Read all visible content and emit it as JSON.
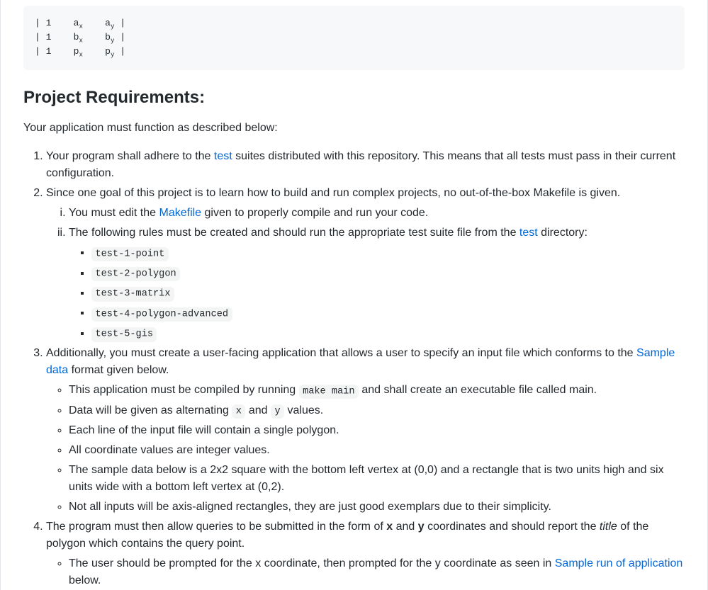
{
  "matrix": {
    "rows": [
      {
        "c0": "| 1",
        "v": "a",
        "s1": "x",
        "w": "a",
        "s2": "y",
        "end": "|"
      },
      {
        "c0": "| 1",
        "v": "b",
        "s1": "x",
        "w": "b",
        "s2": "y",
        "end": "|"
      },
      {
        "c0": "| 1",
        "v": "p",
        "s1": "x",
        "w": "p",
        "s2": "y",
        "end": "|"
      }
    ]
  },
  "headings": {
    "requirements": "Project Requirements:"
  },
  "intro": "Your application must function as described below:",
  "req1": {
    "pre": "Your program shall adhere to the ",
    "link": "test",
    "post": " suites distributed with this repository. This means that all tests must pass in their current configuration."
  },
  "req2": {
    "text": "Since one goal of this project is to learn how to build and run complex projects, no out-of-the-box Makefile is given.",
    "i": {
      "pre": "You must edit the ",
      "link": "Makefile",
      "post": " given to properly compile and run your code."
    },
    "ii": {
      "pre": "The following rules must be created and should run the appropriate test suite file from the ",
      "link": "test",
      "post": " directory:"
    },
    "rules": [
      "test-1-point",
      "test-2-polygon",
      "test-3-matrix",
      "test-4-polygon-advanced",
      "test-5-gis"
    ]
  },
  "req3": {
    "pre": "Additionally, you must create a user-facing application that allows a user to specify an input file which conforms to the ",
    "link": "Sample data",
    "post": " format given below.",
    "a_pre": "This application must be compiled by running ",
    "a_code": "make main",
    "a_post": " and shall create an executable file called main.",
    "b_pre": "Data will be given as alternating ",
    "b_x": "x",
    "b_mid": " and ",
    "b_y": "y",
    "b_post": " values.",
    "c": "Each line of the input file will contain a single polygon.",
    "d": "All coordinate values are integer values.",
    "e": "The sample data below is a 2x2 square with the bottom left vertex at (0,0) and a rectangle that is two units high and six units wide with a bottom left vertex at (0,2).",
    "f": "Not all inputs will be axis-aligned rectangles, they are just good exemplars due to their simplicity."
  },
  "req4": {
    "pre": "The program must then allow queries to be submitted in the form of ",
    "x": "x",
    "mid1": " and ",
    "y": "y",
    "mid2": " coordinates and should report the ",
    "title": "title",
    "post": " of the polygon which contains the query point.",
    "a_pre": "The user should be prompted for the x coordinate, then prompted for the y coordinate as seen in ",
    "a_link": "Sample run of application",
    "a_post": " below."
  }
}
